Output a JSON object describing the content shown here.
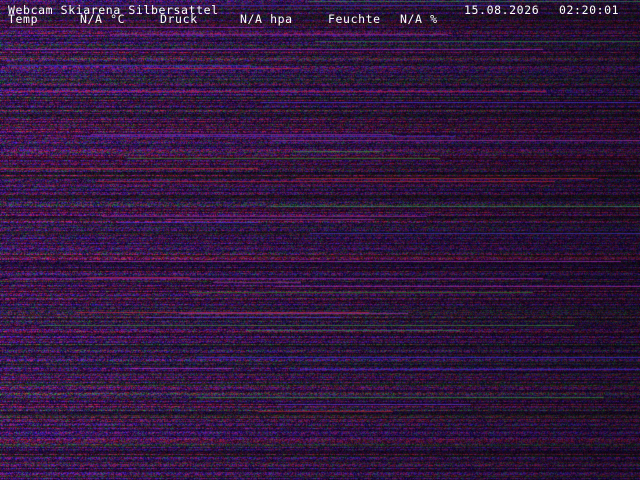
{
  "overlay": {
    "title": "Webcam Skiarena Silbersattel",
    "date": "15.08.2026",
    "time": "02:20:01",
    "temp_label": "Temp",
    "temp_value": "N/A °C",
    "pressure_label": "Druck",
    "pressure_value": "N/A hpa",
    "humidity_label": "Feuchte",
    "humidity_value": "N/A %"
  },
  "image": {
    "content": "static-noise",
    "palette": [
      "#1a0f8a",
      "#6a1b9a",
      "#c21a3a",
      "#1f8f3a",
      "#2030d0",
      "#000000"
    ]
  }
}
